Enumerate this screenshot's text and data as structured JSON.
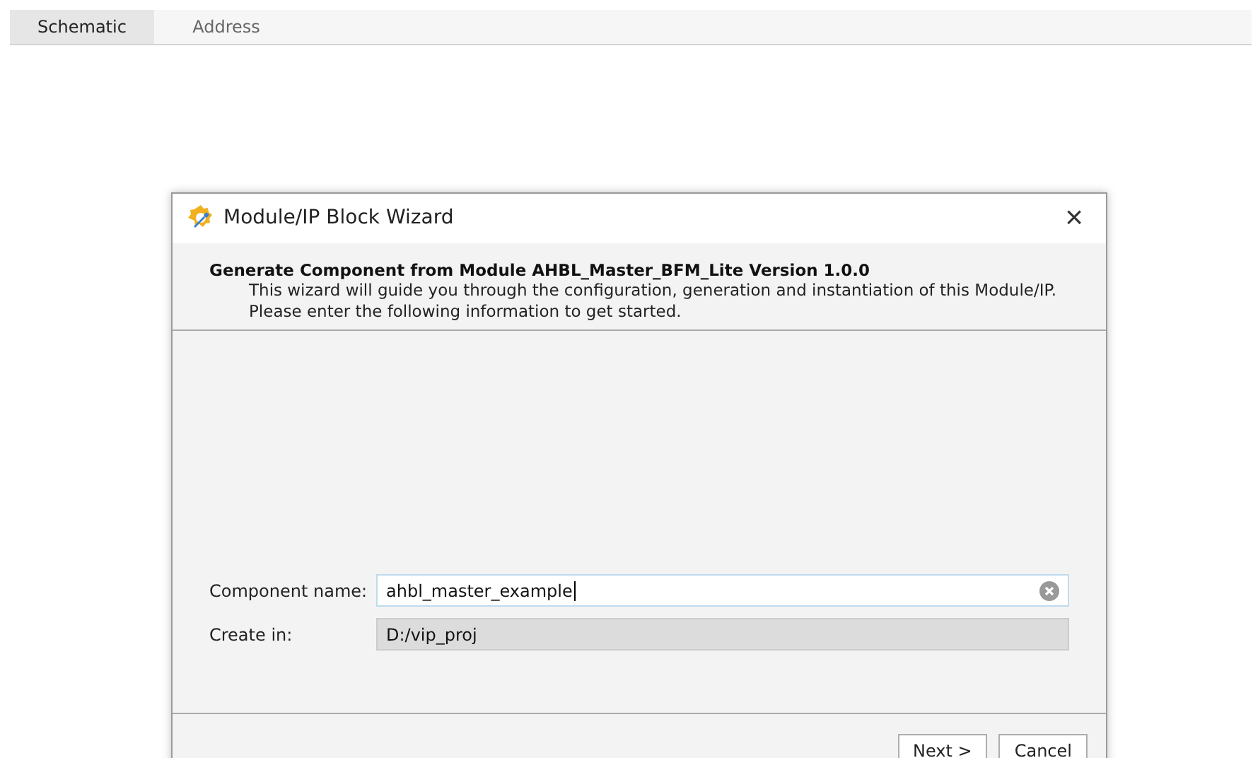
{
  "tabs": [
    {
      "label": "Schematic",
      "selected": true
    },
    {
      "label": "Address",
      "selected": false
    }
  ],
  "dialog": {
    "title": "Module/IP Block Wizard",
    "close": "×",
    "heading": "Generate Component from Module AHBL_Master_BFM_Lite Version 1.0.0",
    "description": [
      "This wizard will guide you through the configuration, generation and instantiation of this Module/IP.",
      "Please enter the following information to get started."
    ],
    "fields": [
      {
        "label": "Component name:",
        "value": "ahbl_master_example",
        "disabled": false
      },
      {
        "label": "Create in:",
        "value": "D:/vip_proj",
        "disabled": true
      }
    ],
    "buttons": [
      "Next >",
      "Cancel"
    ]
  }
}
